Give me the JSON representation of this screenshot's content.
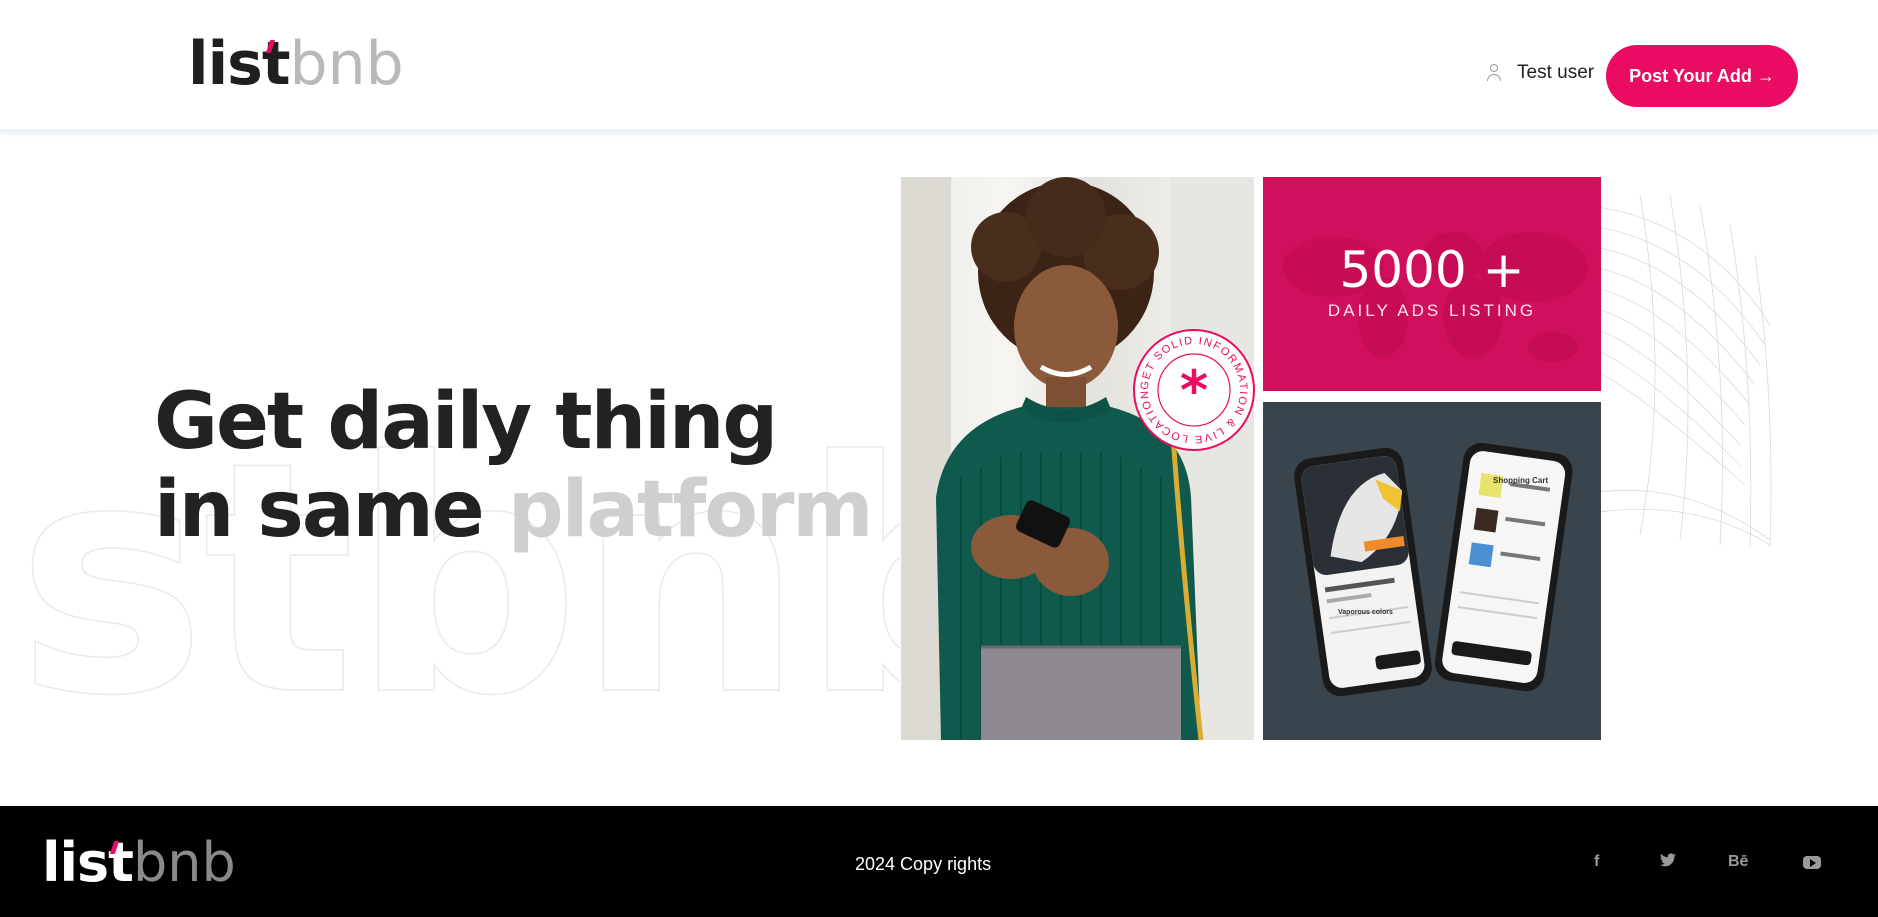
{
  "brand": {
    "logo_dark": "list",
    "logo_light": "bnb",
    "accent": "#ea0c62"
  },
  "header": {
    "user_icon": "user-icon",
    "user_name": "Test user",
    "post_button_label": "Post Your Add →"
  },
  "hero": {
    "headline_line1": "Get daily thing",
    "headline_line2_dark": "in same ",
    "headline_line2_light": "platform",
    "background_text": "stbnb"
  },
  "promo": {
    "badge_text": "GET SOLID INFORMATION & LIVE LOCATION -",
    "badge_icon": "asterisk-icon",
    "stats_value": "5000 +",
    "stats_label": "DAILY ADS LISTING",
    "phone_right_title": "Shopping Cart",
    "phone_left_title": "Vaporous colors"
  },
  "footer": {
    "copyright": "2024 Copy rights",
    "social": [
      "facebook-icon",
      "twitter-icon",
      "behance-icon",
      "youtube-icon"
    ],
    "facebook_glyph": "f",
    "twitter_glyph": "🐦",
    "behance_glyph": "Bē"
  }
}
